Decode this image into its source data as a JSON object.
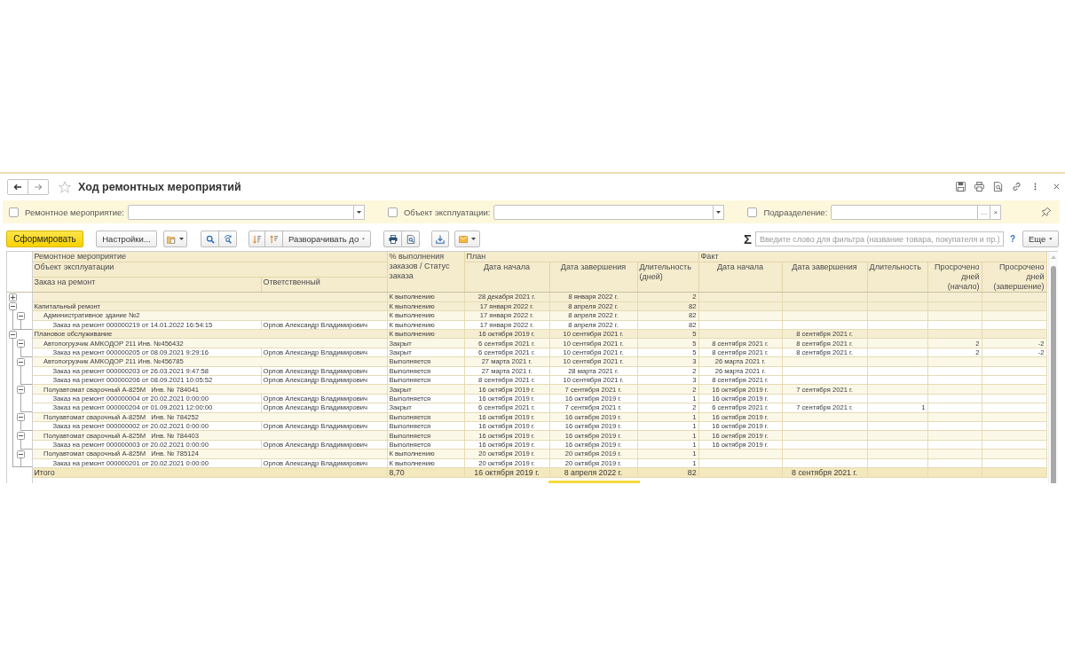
{
  "window": {
    "title": "Ход ремонтных мероприятий"
  },
  "filters": [
    {
      "kind": "dropdown",
      "checked": false,
      "label": "Ремонтное мероприятие:"
    },
    {
      "kind": "dropdown",
      "checked": false,
      "label": "Объект эксплуатации:"
    },
    {
      "kind": "choice",
      "checked": false,
      "label": "Подразделение:",
      "choice_button": "...",
      "clear_button": "×"
    }
  ],
  "toolbar": {
    "generate_button": "Сформировать",
    "settings_button": "Настройки...",
    "expand_button": "Разворачивать до",
    "sum_button": "Σ",
    "search": {
      "placeholder": "Введите слово для фильтра (название товара, покупателя и пр.)"
    },
    "help_button": "?",
    "more_button": "Еще"
  },
  "table": {
    "header": {
      "activity": "Ремонтное мероприятие",
      "object": "Объект эксплуатации",
      "order": "Заказ на ремонт",
      "responsible": "Ответственный",
      "status": "% выполнения заказов / Статус заказа",
      "plan": {
        "title": "План",
        "columns": [
          "Дата начала",
          "Дата завершения",
          "Длительность (дней)"
        ]
      },
      "fact": {
        "title": "Факт",
        "columns": [
          "Дата начала",
          "Дата завершения",
          "Длительность",
          "Просрочено дней (начало)",
          "Просрочено дней (завершение)"
        ]
      }
    },
    "rows": [
      {
        "kind": "group",
        "expanded": false,
        "status": "К выполнению",
        "plan": {
          "start": "28 декабря 2021 г.",
          "end": "8 января 2022 г.",
          "duration": "2"
        }
      },
      {
        "kind": "group",
        "expanded": true,
        "name": "Капитальный ремонт",
        "status": "К выполнению",
        "plan": {
          "start": "17 января 2022 г.",
          "end": "8 апреля 2022 г.",
          "duration": "82"
        },
        "children": [
          {
            "kind": "object",
            "expanded": true,
            "name": "Административное здание №2",
            "status": "К выполнению",
            "plan": {
              "start": "17 января 2022 г.",
              "end": "8 апреля 2022 г.",
              "duration": "82"
            },
            "children": [
              {
                "kind": "order",
                "name": "Заказ на ремонт 000000219 от 14.01.2022 16:54:15",
                "responsible": "Орлов Александр Владимирович",
                "status": "К выполнению",
                "plan": {
                  "start": "17 января 2022 г.",
                  "end": "8 апреля 2022 г.",
                  "duration": "82"
                }
              }
            ]
          }
        ]
      },
      {
        "kind": "group",
        "expanded": true,
        "name": "Плановое обслуживание",
        "status": "К выполнению",
        "plan": {
          "start": "16 октября 2019 г.",
          "end": "10 сентября 2021 г.",
          "duration": "5"
        },
        "fact": {
          "end": "8 сентября 2021 г."
        },
        "children": [
          {
            "kind": "object",
            "expanded": true,
            "name": "Автопогрузчик АМКОДОР 211 Инв. №456432",
            "status": "Закрыт",
            "plan": {
              "start": "6 сентября 2021 г.",
              "end": "10 сентября 2021 г.",
              "duration": "5"
            },
            "fact": {
              "start": "8 сентября 2021 г.",
              "end": "8 сентября 2021 г.",
              "overdue_start": "2",
              "overdue_end": "-2"
            },
            "children": [
              {
                "kind": "order",
                "name": "Заказ на ремонт 000000205 от 08.09.2021 9:29:16",
                "responsible": "Орлов Александр Владимирович",
                "status": "Закрыт",
                "plan": {
                  "start": "6 сентября 2021 г.",
                  "end": "10 сентября 2021 г.",
                  "duration": "5"
                },
                "fact": {
                  "start": "8 сентября 2021 г.",
                  "end": "8 сентября 2021 г.",
                  "overdue_start": "2",
                  "overdue_end": "-2"
                }
              }
            ]
          },
          {
            "kind": "object",
            "expanded": true,
            "name": "Автопогрузчик АМКОДОР 211 Инв. №456785",
            "status": "Выполняется",
            "plan": {
              "start": "27 марта 2021 г.",
              "end": "10 сентября 2021 г.",
              "duration": "3"
            },
            "fact": {
              "start": "26 марта 2021 г."
            },
            "children": [
              {
                "kind": "order",
                "name": "Заказ на ремонт 000000203 от 26.03.2021 9:47:58",
                "responsible": "Орлов Александр Владимирович",
                "status": "Выполняется",
                "plan": {
                  "start": "27 марта 2021 г.",
                  "end": "28 марта 2021 г.",
                  "duration": "2"
                },
                "fact": {
                  "start": "26 марта 2021 г."
                }
              },
              {
                "kind": "order",
                "name": "Заказ на ремонт 000000206 от 08.09.2021 10:05:52",
                "responsible": "Орлов Александр Владимирович",
                "status": "Выполняется",
                "plan": {
                  "start": "8 сентября 2021 г.",
                  "end": "10 сентября 2021 г.",
                  "duration": "3"
                },
                "fact": {
                  "start": "8 сентября 2021 г."
                }
              }
            ]
          },
          {
            "kind": "object",
            "expanded": true,
            "name": "Полуавтомат сварочный А-825М   Инв. № 784041",
            "status": "Закрыт",
            "plan": {
              "start": "16 октября 2019 г.",
              "end": "7 сентября 2021 г.",
              "duration": "2"
            },
            "fact": {
              "start": "16 октября 2019 г.",
              "end": "7 сентября 2021 г."
            },
            "children": [
              {
                "kind": "order",
                "name": "Заказ на ремонт 000000004 от 20.02.2021 0:00:00",
                "responsible": "Орлов Александр Владимирович",
                "status": "Выполняется",
                "plan": {
                  "start": "16 октября 2019 г.",
                  "end": "16 октября 2019 г.",
                  "duration": "1"
                },
                "fact": {
                  "start": "16 октября 2019 г."
                }
              },
              {
                "kind": "order",
                "name": "Заказ на ремонт 000000204 от 01.09.2021 12:00:00",
                "responsible": "Орлов Александр Владимирович",
                "status": "Закрыт",
                "plan": {
                  "start": "6 сентября 2021 г.",
                  "end": "7 сентября 2021 г.",
                  "duration": "2"
                },
                "fact": {
                  "start": "6 сентября 2021 г.",
                  "end": "7 сентября 2021 г.",
                  "duration": "1"
                }
              }
            ]
          },
          {
            "kind": "object",
            "expanded": true,
            "name": "Полуавтомат сварочный А-825М   Инв. № 784252",
            "status": "Выполняется",
            "plan": {
              "start": "16 октября 2019 г.",
              "end": "16 октября 2019 г.",
              "duration": "1"
            },
            "fact": {
              "start": "16 октября 2019 г."
            },
            "children": [
              {
                "kind": "order",
                "name": "Заказ на ремонт 000000002 от 20.02.2021 0:00:00",
                "responsible": "Орлов Александр Владимирович",
                "status": "Выполняется",
                "plan": {
                  "start": "16 октября 2019 г.",
                  "end": "16 октября 2019 г.",
                  "duration": "1"
                },
                "fact": {
                  "start": "16 октября 2019 г."
                }
              }
            ]
          },
          {
            "kind": "object",
            "expanded": true,
            "name": "Полуавтомат сварочный А-825М   Инв. № 784403",
            "status": "Выполняется",
            "plan": {
              "start": "16 октября 2019 г.",
              "end": "16 октября 2019 г.",
              "duration": "1"
            },
            "fact": {
              "start": "16 октября 2019 г."
            },
            "children": [
              {
                "kind": "order",
                "name": "Заказ на ремонт 000000003 от 20.02.2021 0:00:00",
                "responsible": "Орлов Александр Владимирович",
                "status": "Выполняется",
                "plan": {
                  "start": "16 октября 2019 г.",
                  "end": "16 октября 2019 г.",
                  "duration": "1"
                },
                "fact": {
                  "start": "16 октября 2019 г."
                }
              }
            ]
          },
          {
            "kind": "object",
            "expanded": true,
            "name": "Полуавтомат сварочный А-825М   Инв. № 785124",
            "status": "К выполнению",
            "plan": {
              "start": "20 октября 2019 г.",
              "end": "20 октября 2019 г.",
              "duration": "1"
            },
            "children": [
              {
                "kind": "order",
                "name": "Заказ на ремонт 000000201 от 20.02.2021 0:00:00",
                "responsible": "Орлов Александр Владимирович",
                "status": "К выполнению",
                "plan": {
                  "start": "20 октября 2019 г.",
                  "end": "20 октября 2019 г.",
                  "duration": "1"
                }
              }
            ]
          }
        ]
      }
    ],
    "total": {
      "label": "Итого",
      "status": "8,70",
      "plan": {
        "start": "16 октября 2019 г.",
        "end": "8 апреля 2022 г.",
        "duration": "82"
      },
      "fact": {
        "end": "8 сентября 2021 г."
      }
    }
  }
}
